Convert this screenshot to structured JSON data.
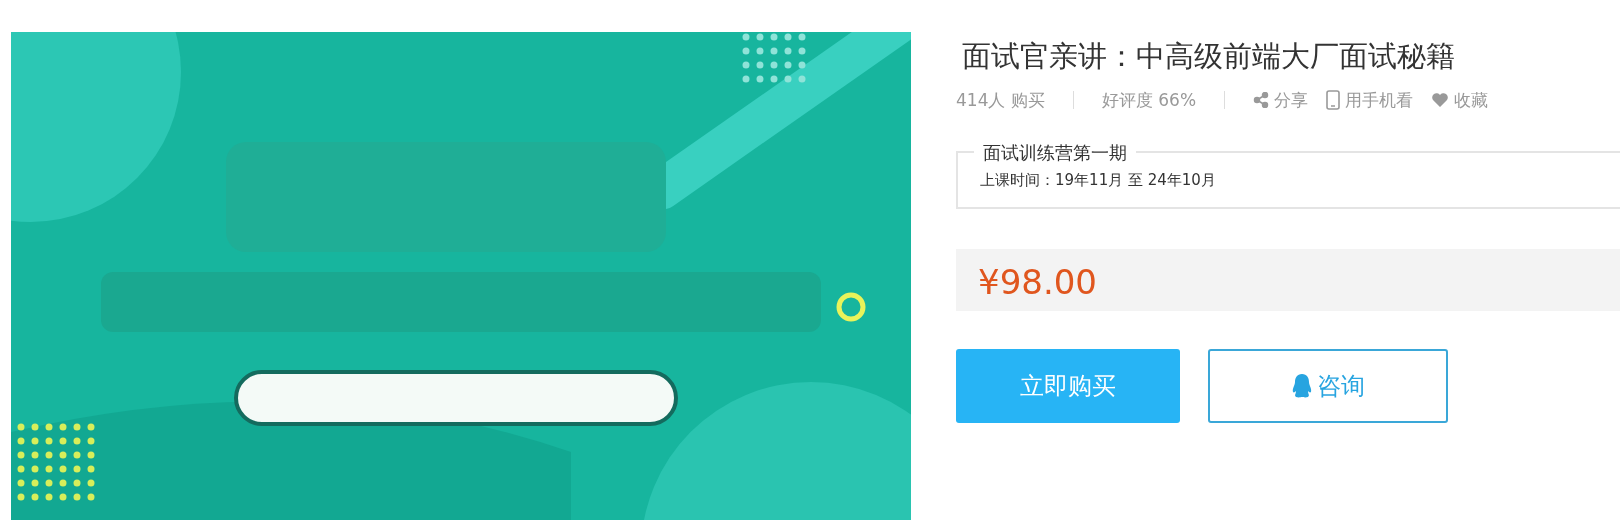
{
  "title": "面试官亲讲：中高级前端大厂面试秘籍",
  "stats": [
    {
      "text": "414人 购买"
    },
    {
      "text": "好评度 66%"
    }
  ],
  "actions": [
    {
      "kind": "share",
      "label": "分享"
    },
    {
      "kind": "phone",
      "label": "用手机看"
    },
    {
      "kind": "heart",
      "label": "收藏"
    }
  ],
  "session": {
    "name": "面试训练营第一期",
    "time": "上课时间：19年11月 至 24年10月"
  },
  "price": "¥98.00",
  "buttons": [
    {
      "kind": "buy",
      "label": "立即购买"
    },
    {
      "kind": "consult",
      "label": "咨询"
    }
  ]
}
